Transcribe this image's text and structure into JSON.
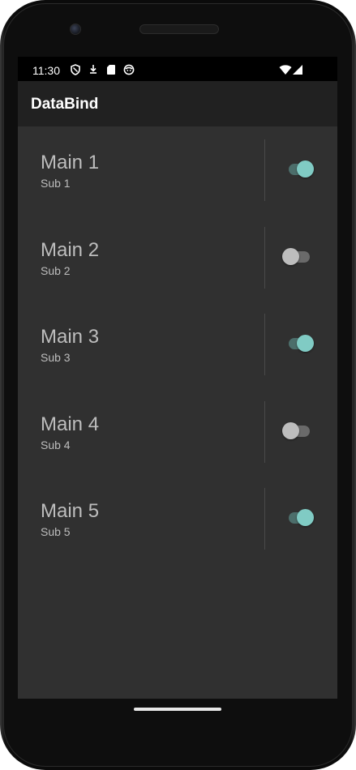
{
  "status_bar": {
    "time": "11:30",
    "icons": [
      "shield-icon",
      "download-icon",
      "sd-card-icon",
      "face-icon"
    ],
    "right_icons": [
      "wifi-icon",
      "signal-icon"
    ]
  },
  "app_bar": {
    "title": "DataBind"
  },
  "list": {
    "items": [
      {
        "main": "Main 1",
        "sub": "Sub 1",
        "switch_on": true
      },
      {
        "main": "Main 2",
        "sub": "Sub 2",
        "switch_on": false
      },
      {
        "main": "Main 3",
        "sub": "Sub 3",
        "switch_on": true
      },
      {
        "main": "Main 4",
        "sub": "Sub 4",
        "switch_on": false
      },
      {
        "main": "Main 5",
        "sub": "Sub 5",
        "switch_on": true
      }
    ]
  },
  "colors": {
    "accent": "#80cbc4",
    "background": "#303030",
    "app_bar": "#212121",
    "text": "#bdbdbd"
  }
}
